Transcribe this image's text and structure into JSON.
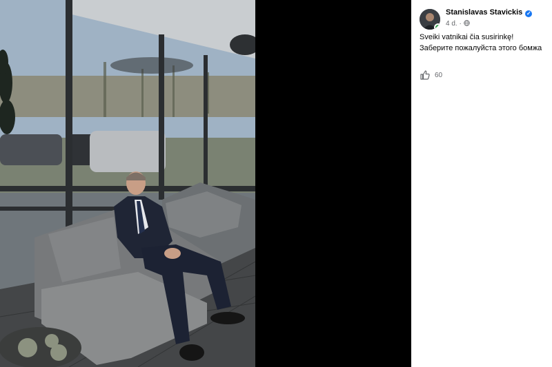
{
  "post": {
    "author": "Stanislavas Stavickis",
    "time": "4 d.",
    "text_line1": "Sveiki vatnikai čia susirinkę!",
    "text_line2": "Заберите пожалуйста этого бомжа",
    "likes": "60"
  },
  "icons": {
    "verified": "verified-badge-icon",
    "privacy": "globe-icon",
    "like": "thumbs-up-icon"
  },
  "colors": {
    "accent": "#1877f2",
    "online": "#31a24c",
    "secondary_text": "#65676b"
  }
}
